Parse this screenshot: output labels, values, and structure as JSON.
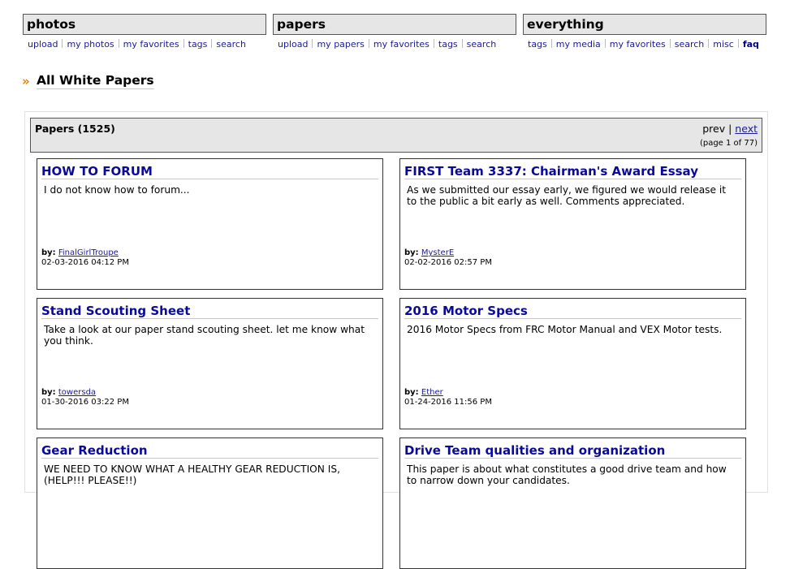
{
  "tabs": [
    {
      "label": "photos",
      "links": [
        "upload",
        "my photos",
        "my favorites",
        "tags",
        "search"
      ]
    },
    {
      "label": "papers",
      "links": [
        "upload",
        "my papers",
        "my favorites",
        "tags",
        "search"
      ]
    },
    {
      "label": "everything",
      "links": [
        "tags",
        "my media",
        "my favorites",
        "search",
        "misc",
        "faq"
      ]
    }
  ],
  "page": {
    "title": "All White Papers"
  },
  "listing": {
    "header": "Papers (1525)",
    "prev": "prev",
    "separator": "|",
    "next": "next",
    "page_info": "(page 1 of 77)"
  },
  "by_label": "by:",
  "papers": [
    {
      "title": "HOW TO FORUM",
      "description": "I do not know how to forum...",
      "author": "FinalGirlTroupe",
      "date": "02-03-2016 04:12 PM"
    },
    {
      "title": "FIRST Team 3337: Chairman's Award Essay",
      "description": "As we submitted our essay early, we figured we would release it to the public a bit early as well. Comments appreciated.",
      "author": "MysterE",
      "date": "02-02-2016 02:57 PM"
    },
    {
      "title": "Stand Scouting Sheet",
      "description": "Take a look at our paper stand scouting sheet. let me know what you think.",
      "author": "towersda",
      "date": "01-30-2016 03:22 PM"
    },
    {
      "title": "2016 Motor Specs",
      "description": "2016 Motor Specs from FRC Motor Manual and VEX Motor tests.",
      "author": "Ether",
      "date": "01-24-2016 11:56 PM"
    },
    {
      "title": "Gear Reduction",
      "description": "WE NEED TO KNOW WHAT A HEALTHY GEAR REDUCTION IS, (HELP!!! PLEASE!!)",
      "author": "",
      "date": ""
    },
    {
      "title": "Drive Team qualities and organization",
      "description": "This paper is about what constitutes a good drive team and how to narrow down your candidates.",
      "author": "",
      "date": ""
    }
  ],
  "colors": {
    "accent": "#f08000",
    "link": "#1a1a99",
    "title": "#0a0a9a",
    "box_bg": "#e6e6e6"
  }
}
